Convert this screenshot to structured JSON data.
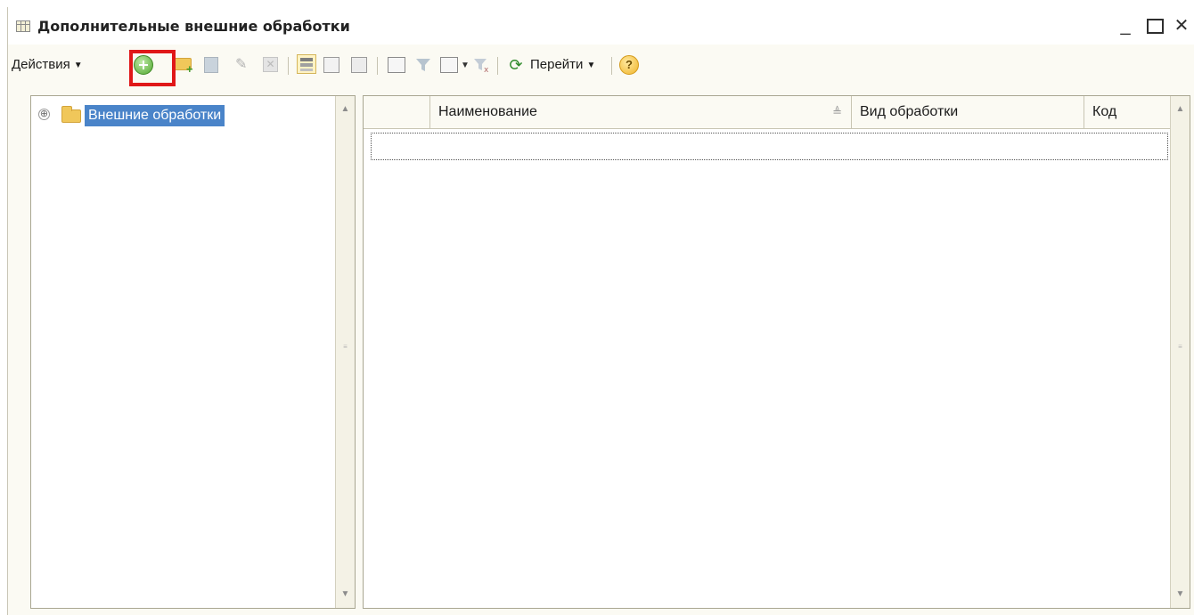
{
  "window": {
    "title": "Дополнительные внешние обработки",
    "minimize": "_",
    "close": "✕"
  },
  "toolbar": {
    "actions_label": "Действия",
    "goto_label": "Перейти",
    "help": "?",
    "highlighted_button": "add-button",
    "highlight_color": "#e01818",
    "icons": [
      "add-icon",
      "add-folder-icon",
      "copy-icon",
      "edit-icon",
      "delete-icon",
      "tree-view-icon",
      "hierarchy-select-icon",
      "move-to-group-icon",
      "set-filter-icon",
      "filter-by-value-icon",
      "filter-history-icon",
      "clear-filter-icon",
      "refresh-icon",
      "help-icon"
    ]
  },
  "tree": {
    "expander": "⊕",
    "root_label": "Внешние обработки",
    "selected_color": "#4a84c9"
  },
  "table": {
    "columns": [
      "Наименование",
      "Вид обработки",
      "Код"
    ],
    "sort_indicator": "≜",
    "rows": []
  },
  "scroll": {
    "up": "▲",
    "down": "▼",
    "thumb": "≡"
  }
}
